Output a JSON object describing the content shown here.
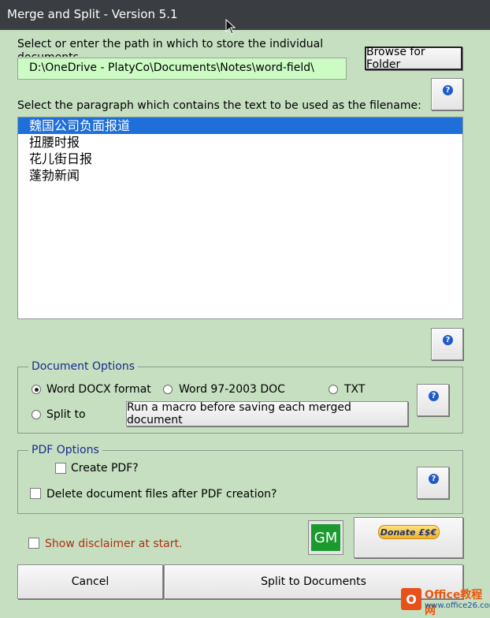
{
  "window": {
    "title": "Merge and Split - Version 5.1"
  },
  "folder": {
    "prompt": "Select or enter the path in which to store the individual documents",
    "path": "D:\\OneDrive - PlatyCo\\Documents\\Notes\\word-field\\",
    "browse_label": "Browse for Folder"
  },
  "help": {
    "glyph": "?"
  },
  "paragraph": {
    "prompt": "Select the paragraph which contains the text to be used as the filename:",
    "items": [
      "魏国公司负面报道",
      "扭腰时报",
      "花儿街日报",
      "蓬勃新闻"
    ],
    "selected_index": 0
  },
  "document_options": {
    "legend": "Document Options",
    "word_docx": "Word DOCX format",
    "word_doc": "Word 97-2003 DOC",
    "txt": "TXT",
    "split_to": "Split to",
    "macro_button": "Run a macro before saving each merged document",
    "selected": "Word DOCX format"
  },
  "pdf_options": {
    "legend": "PDF Options",
    "create_pdf": "Create PDF?",
    "delete_after": "Delete document files after PDF creation?",
    "create_pdf_checked": false,
    "delete_after_checked": false
  },
  "footer": {
    "disclaimer": "Show disclaimer at start.",
    "disclaimer_checked": false,
    "gm_label": "GM",
    "donate_label": "Donate £$€",
    "cancel_label": "Cancel",
    "split_label": "Split to Documents"
  },
  "watermark": {
    "logo_letter": "O",
    "line1": "Office教程网",
    "line2": "www.office26.com"
  },
  "colors": {
    "background": "#c5dfc0",
    "titlebar": "#3a3d41",
    "path_field": "#ccfcc4",
    "selection": "#1e6fd9",
    "legend_text": "#1a2a8f",
    "disclaimer_text": "#b03010",
    "gm_green": "#1a9a2f"
  }
}
